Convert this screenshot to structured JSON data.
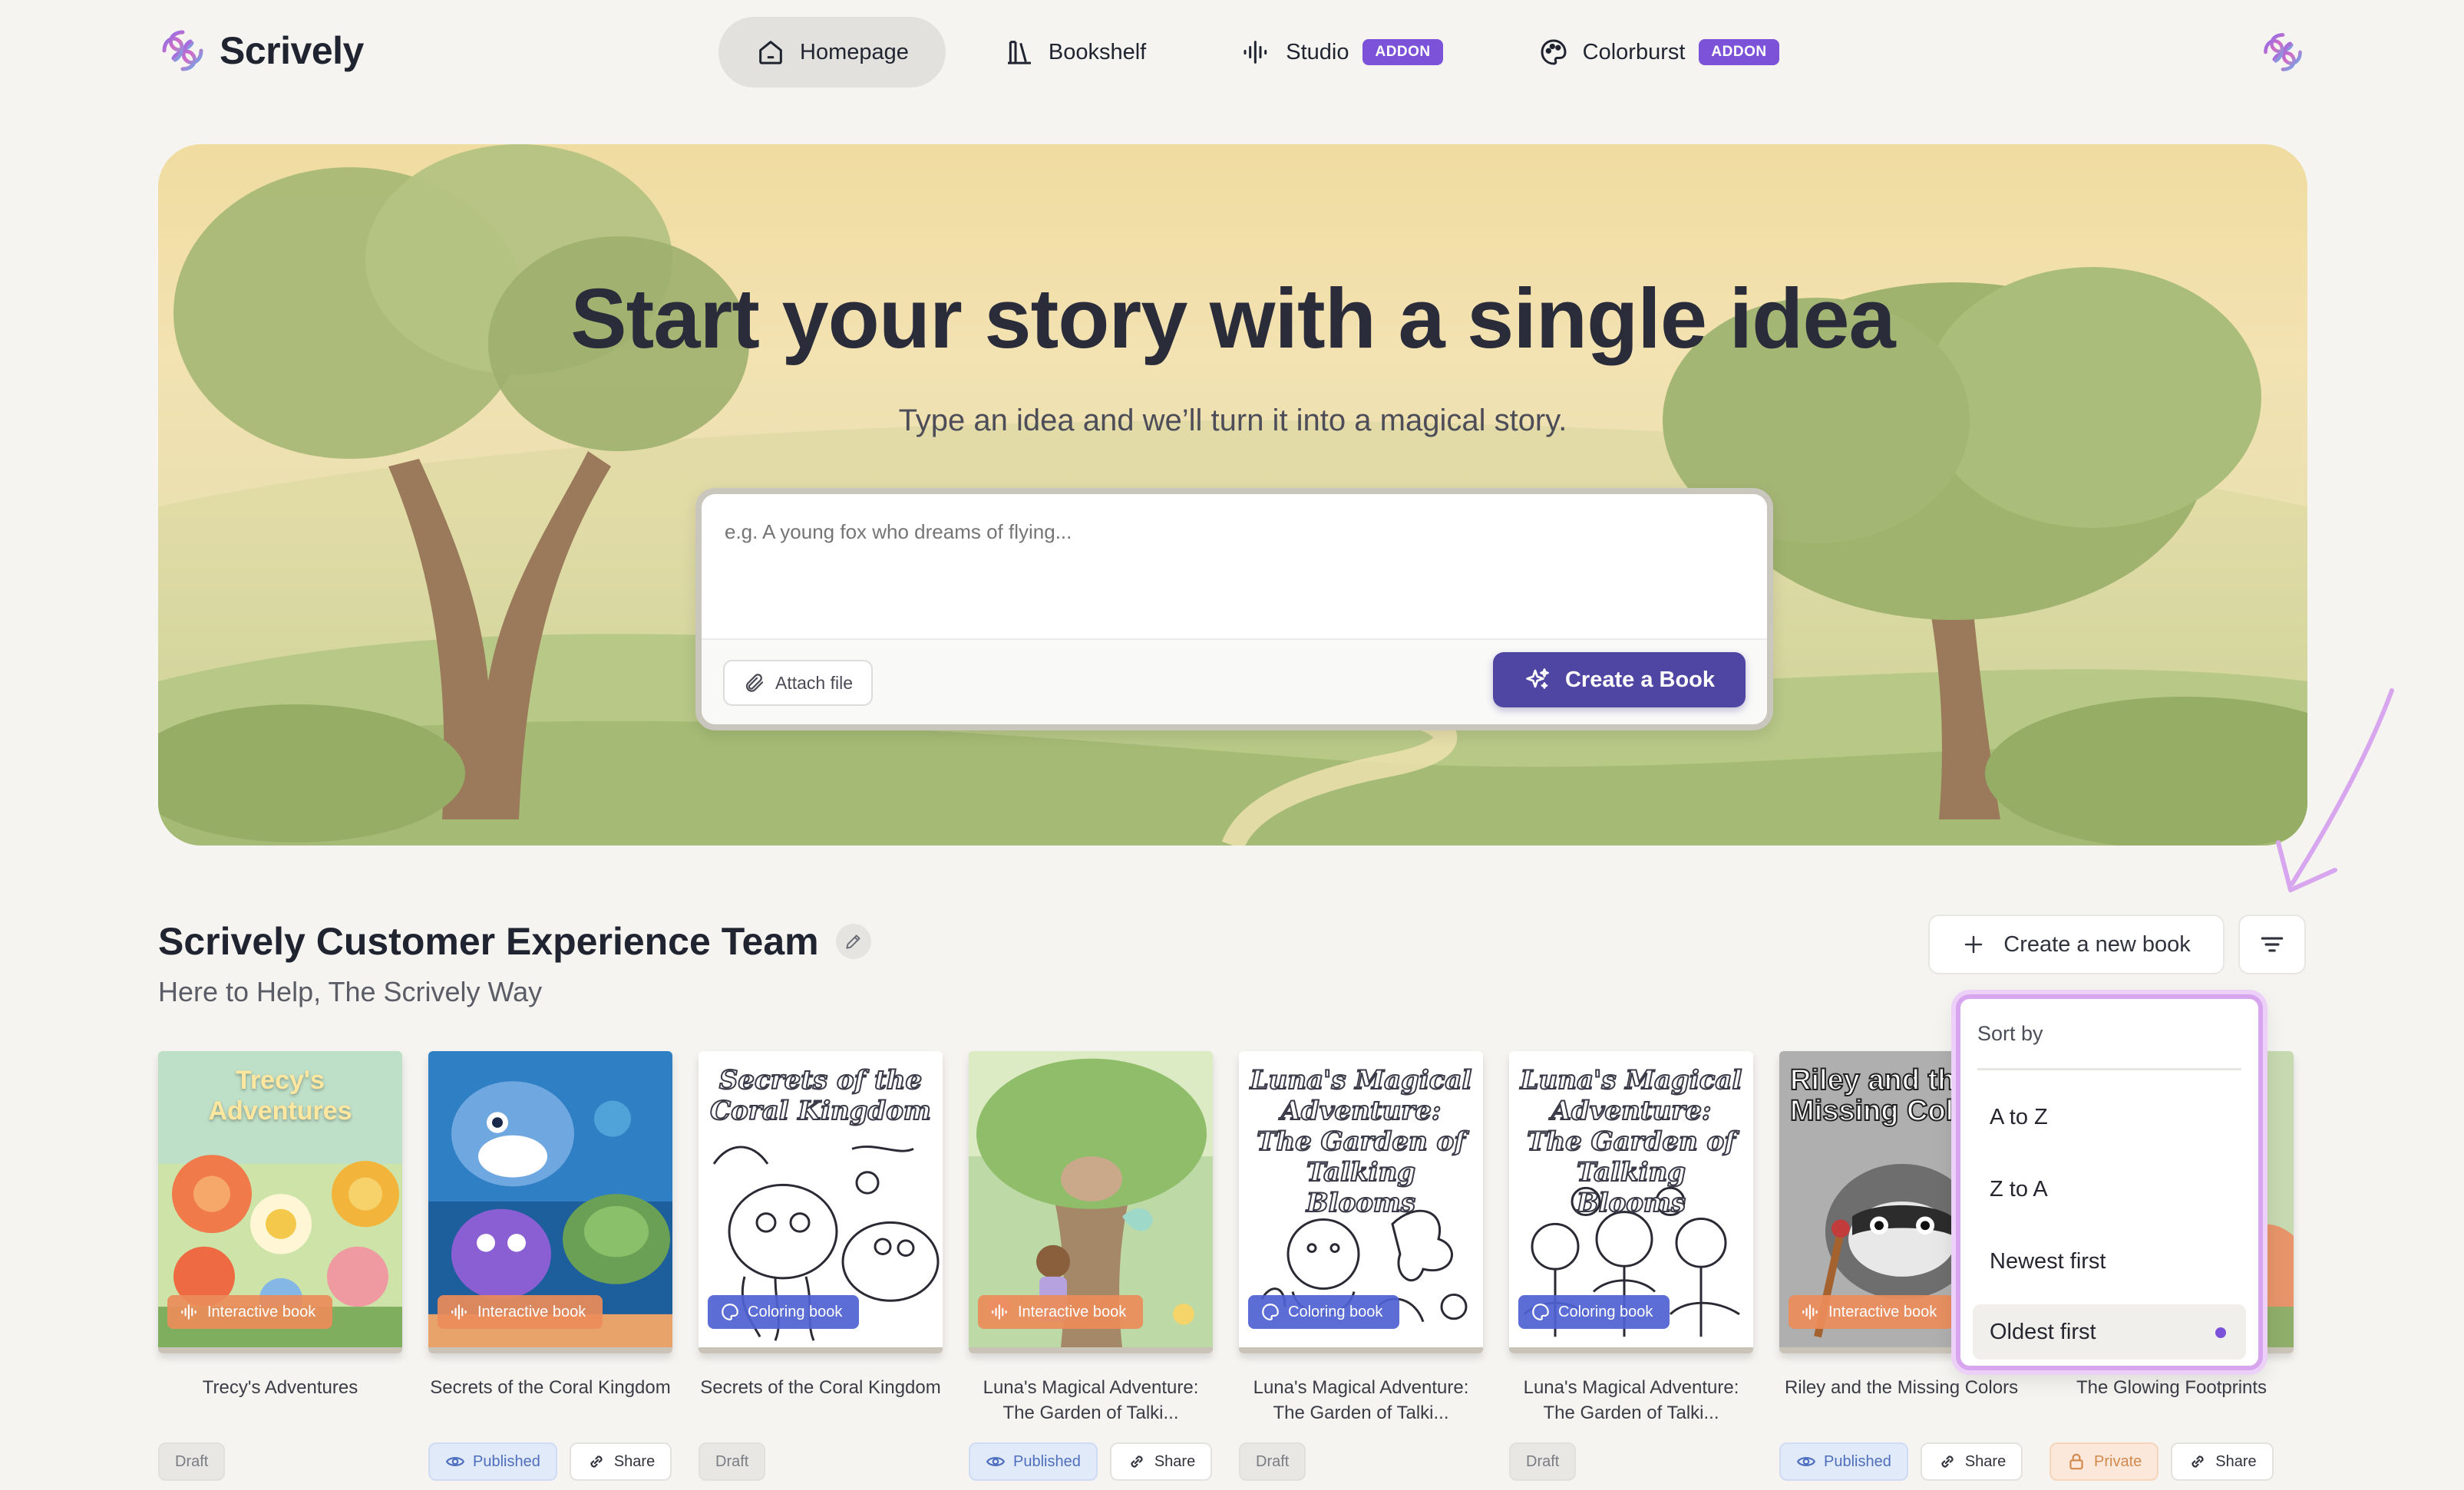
{
  "brand": {
    "name": "Scrively"
  },
  "nav": {
    "items": [
      {
        "label": "Homepage",
        "icon": "home-icon",
        "active": true
      },
      {
        "label": "Bookshelf",
        "icon": "bookshelf-icon",
        "active": false
      },
      {
        "label": "Studio",
        "icon": "audio-wave-icon",
        "badge": "ADDON",
        "active": false
      },
      {
        "label": "Colorburst",
        "icon": "palette-icon",
        "badge": "ADDON",
        "active": false
      }
    ]
  },
  "hero": {
    "title": "Start your story with a single idea",
    "subtitle": "Type an idea and we’ll turn it into a magical story.",
    "prompt_placeholder": "e.g. A young fox who dreams of flying...",
    "prompt_value": "",
    "attach_label": "Attach file",
    "create_label": "Create a Book"
  },
  "team": {
    "title": "Scrively Customer Experience Team",
    "subtitle": "Here to Help, The Scrively Way",
    "new_book_label": "Create a new book"
  },
  "sort_menu": {
    "header": "Sort by",
    "options": [
      "A to Z",
      "Z to A",
      "Newest first",
      "Oldest first"
    ],
    "selected": "Oldest first"
  },
  "books": [
    {
      "cover_title": "Trecy's Adventures",
      "title": "Trecy's Adventures",
      "type": "Interactive book",
      "status": "Draft",
      "share": ""
    },
    {
      "cover_title": "",
      "title": "Secrets of the Coral Kingdom",
      "type": "Interactive book",
      "status": "Published",
      "share": "Share"
    },
    {
      "cover_title": "Secrets of the Coral Kingdom",
      "title": "Secrets of the Coral Kingdom",
      "type": "Coloring book",
      "status": "Draft",
      "share": ""
    },
    {
      "cover_title": "",
      "title": "Luna's Magical Adventure: The Garden of Talki...",
      "type": "Interactive book",
      "status": "Published",
      "share": "Share"
    },
    {
      "cover_title": "Luna's Magical Adventure: The Garden of Talking Blooms",
      "title": "Luna's Magical Adventure: The Garden of Talki...",
      "type": "Coloring book",
      "status": "Draft",
      "share": ""
    },
    {
      "cover_title": "Luna's Magical Adventure: The Garden of Talking Blooms",
      "title": "Luna's Magical Adventure: The Garden of Talki...",
      "type": "Coloring book",
      "status": "Draft",
      "share": ""
    },
    {
      "cover_title": "Riley and the Missing Colors",
      "title": "Riley and the Missing Colors",
      "type": "Interactive book",
      "status": "Published",
      "share": "Share"
    },
    {
      "cover_title": "",
      "title": "The Glowing Footprints",
      "type": "",
      "status": "Private",
      "share": "Share"
    }
  ],
  "colors": {
    "accent": "#4f46a3",
    "addon_badge": "#7b52d8",
    "annotation": "#d8a6ee"
  }
}
